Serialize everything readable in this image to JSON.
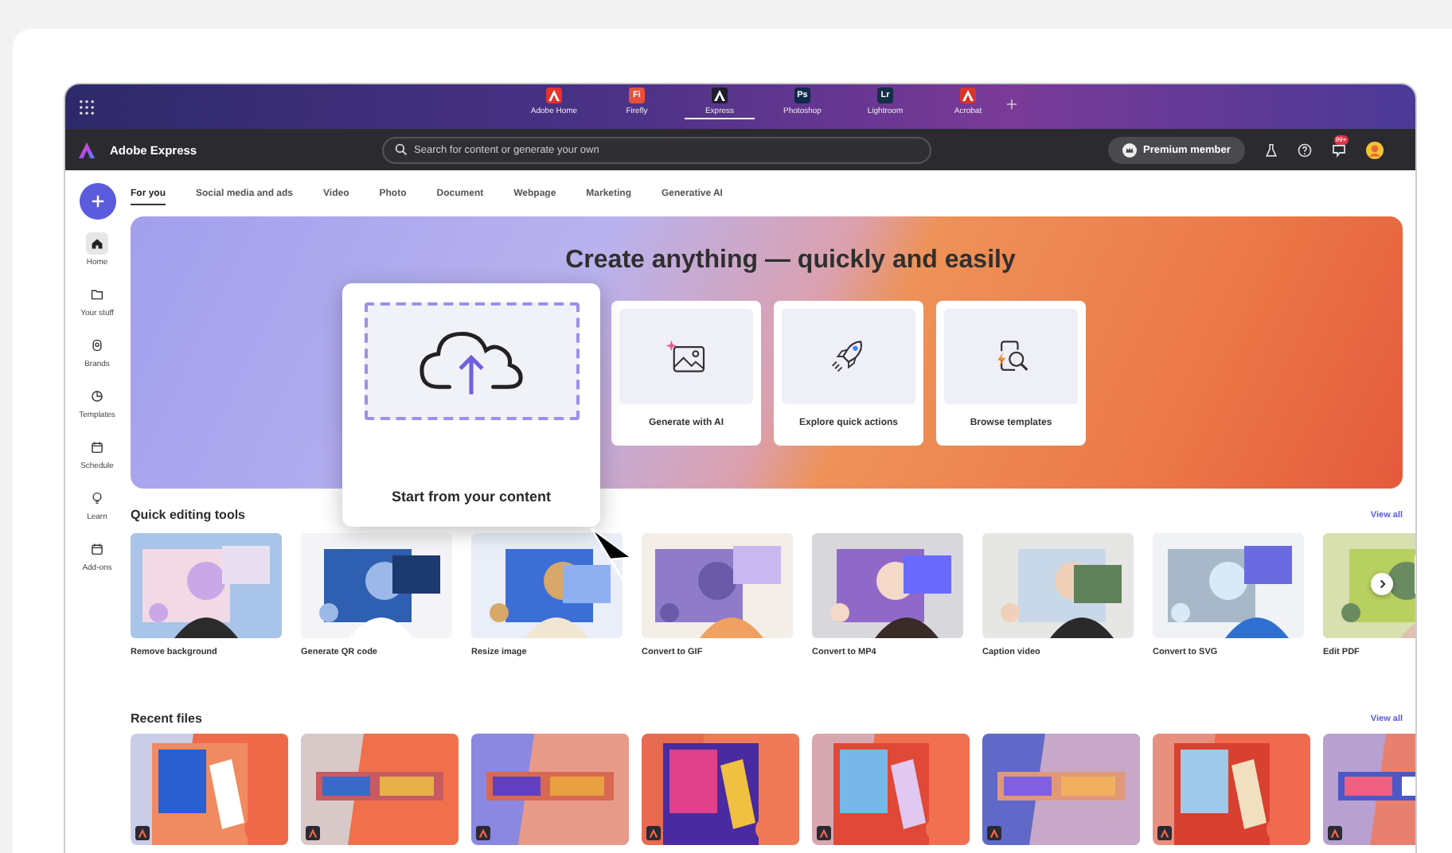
{
  "app_switcher": {
    "apps": [
      {
        "label": "Adobe Home",
        "kind": "logo",
        "color": "#e5322a",
        "selected": false
      },
      {
        "label": "Firefly",
        "kind": "abbr",
        "abbr": "Fi",
        "color": "#e8503c",
        "selected": false
      },
      {
        "label": "Express",
        "kind": "logo",
        "color": "#1d1d2b",
        "selected": true
      },
      {
        "label": "Photoshop",
        "kind": "abbr",
        "abbr": "Ps",
        "color": "#0f2a4a",
        "selected": false
      },
      {
        "label": "Lightroom",
        "kind": "abbr",
        "abbr": "Lr",
        "color": "#123046",
        "selected": false
      },
      {
        "label": "Acrobat",
        "kind": "logo",
        "color": "#d8352a",
        "selected": false
      }
    ]
  },
  "header": {
    "brand": "Adobe Express",
    "search": {
      "placeholder": "Search for content or generate your own"
    },
    "premium": "Premium member",
    "notification_badge": "99+"
  },
  "sidebar": {
    "items": [
      {
        "label": "Home",
        "selected": true
      },
      {
        "label": "Your stuff",
        "selected": false
      },
      {
        "label": "Brands",
        "selected": false
      },
      {
        "label": "Templates",
        "selected": false
      },
      {
        "label": "Schedule",
        "selected": false
      },
      {
        "label": "Learn",
        "selected": false
      },
      {
        "label": "Add-ons",
        "selected": false
      }
    ]
  },
  "tabs": [
    {
      "label": "For you",
      "selected": true
    },
    {
      "label": "Social media and ads",
      "selected": false
    },
    {
      "label": "Video",
      "selected": false
    },
    {
      "label": "Photo",
      "selected": false
    },
    {
      "label": "Document",
      "selected": false
    },
    {
      "label": "Webpage",
      "selected": false
    },
    {
      "label": "Marketing",
      "selected": false
    },
    {
      "label": "Generative AI",
      "selected": false
    }
  ],
  "hero": {
    "title": "Create anything — quickly and easily",
    "featured": "Start from your content",
    "actions": [
      "Generate with AI",
      "Explore quick actions",
      "Browse templates"
    ]
  },
  "quick_tools": {
    "title": "Quick editing tools",
    "view_all": "View all",
    "items": [
      "Remove background",
      "Generate QR code",
      "Resize image",
      "Convert to GIF",
      "Convert to MP4",
      "Caption video",
      "Convert to SVG",
      "Edit PDF"
    ]
  },
  "recent_files": {
    "title": "Recent files",
    "view_all": "View all"
  }
}
